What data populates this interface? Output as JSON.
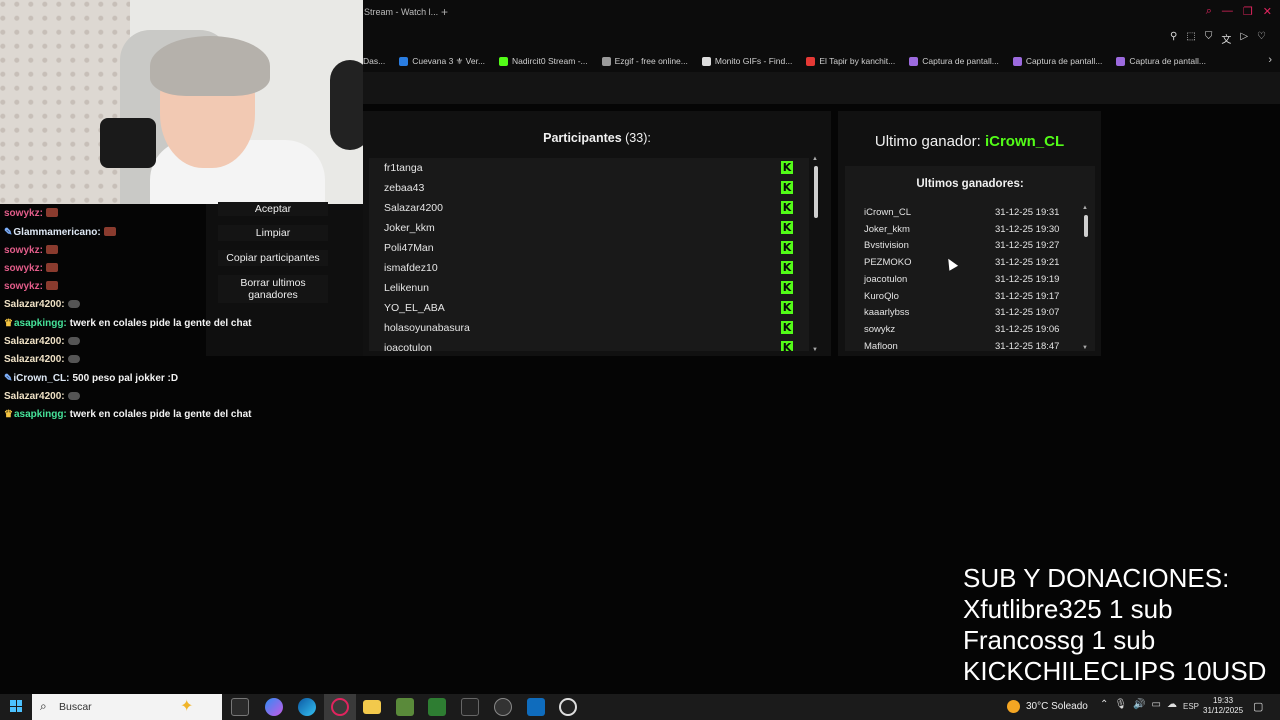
{
  "browser": {
    "tab_title": "Stream - Watch l...",
    "tab_add": "+",
    "bookmarks": [
      {
        "label": "Das...",
        "color": "#555555"
      },
      {
        "label": "Cuevana 3 ⚜ Ver...",
        "color": "#2a7de1"
      },
      {
        "label": "Nadircit0 Stream -...",
        "color": "#53fc18"
      },
      {
        "label": "Ezgif - free online...",
        "color": "#9a9a9a"
      },
      {
        "label": "Monito GIFs - Find...",
        "color": "#dddddd"
      },
      {
        "label": "El Tapir by kanchit...",
        "color": "#e53935"
      },
      {
        "label": "Captura de pantall...",
        "color": "#9c6ade"
      },
      {
        "label": "Captura de pantall...",
        "color": "#9c6ade"
      },
      {
        "label": "Captura de pantall...",
        "color": "#9c6ade"
      }
    ],
    "bookmarks_more": "›"
  },
  "participants": {
    "title": "Participantes",
    "count": "(33):",
    "list": [
      "fr1tanga",
      "zebaa43",
      "Salazar4200",
      "Joker_kkm",
      "Poli47Man",
      "ismafdez10",
      "Lelikenun",
      "YO_EL_ABA",
      "holasoyunabasura",
      "joacotulon"
    ],
    "platform_icon": "K"
  },
  "winner": {
    "label": "Ultimo ganador:",
    "name": "iCrown_CL",
    "list_title": "Ultimos ganadores:",
    "list": [
      {
        "name": "iCrown_CL",
        "date": "31-12-25 19:31"
      },
      {
        "name": "Joker_kkm",
        "date": "31-12-25 19:30"
      },
      {
        "name": "Bvstivision",
        "date": "31-12-25 19:27"
      },
      {
        "name": "PEZMOKO",
        "date": "31-12-25 19:21"
      },
      {
        "name": "joacotulon",
        "date": "31-12-25 19:19"
      },
      {
        "name": "KuroQlo",
        "date": "31-12-25 19:17"
      },
      {
        "name": "kaaarlybss",
        "date": "31-12-25 19:07"
      },
      {
        "name": "sowykz",
        "date": "31-12-25 19:06"
      },
      {
        "name": "Mafloon",
        "date": "31-12-25 18:47"
      }
    ]
  },
  "buttons": {
    "accept": "Aceptar",
    "clear": "Limpiar",
    "copy": "Copiar participantes",
    "delete_winners": "Borrar ultimos ganadores"
  },
  "chat": [
    {
      "user": "sowykz:",
      "text": "",
      "style": "pink"
    },
    {
      "user": "Glammamericano:",
      "text": "",
      "style": "blue"
    },
    {
      "user": "sowykz:",
      "text": "",
      "style": "pink"
    },
    {
      "user": "sowykz:",
      "text": "",
      "style": "pink"
    },
    {
      "user": "sowykz:",
      "text": "",
      "style": "pink"
    },
    {
      "user": "Salazar4200:",
      "text": "",
      "style": "sal"
    },
    {
      "user": "asapkingg:",
      "text": "twerk en colales pide la gente del chat",
      "style": "asap"
    },
    {
      "user": "Salazar4200:",
      "text": "",
      "style": "sal"
    },
    {
      "user": "Salazar4200:",
      "text": "",
      "style": "sal"
    },
    {
      "user": "iCrown_CL:",
      "text": "500 peso pal jokker :D",
      "style": "blue"
    },
    {
      "user": "Salazar4200:",
      "text": "",
      "style": "sal"
    },
    {
      "user": "asapkingg:",
      "text": "twerk en colales pide la gente del chat",
      "style": "asap"
    }
  ],
  "overlay": {
    "lines": [
      "SUB Y DONACIONES:",
      "Xfutlibre325 1 sub",
      "Francossg 1 sub",
      "KICKCHILECLIPS 10USD"
    ]
  },
  "taskbar": {
    "search_placeholder": "Buscar",
    "weather": "30°C  Soleado",
    "lang": "ESP",
    "time": "19:33",
    "date": "31/12/2025"
  }
}
